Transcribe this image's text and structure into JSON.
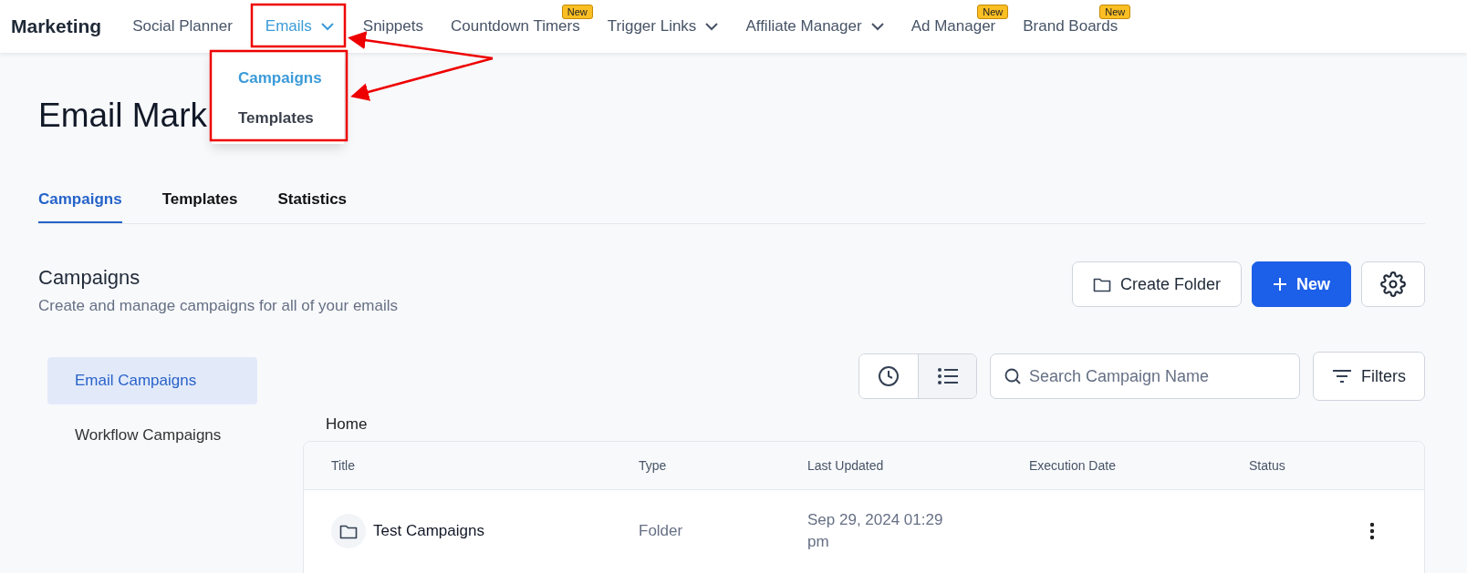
{
  "app_title": "Marketing",
  "nav": [
    {
      "label": "Social Planner",
      "selected": false,
      "dropdown": false
    },
    {
      "label": "Emails",
      "selected": true,
      "dropdown": true
    },
    {
      "label": "Snippets",
      "selected": false,
      "dropdown": false
    },
    {
      "label": "Countdown Timers",
      "selected": false,
      "dropdown": false,
      "badge": "New"
    },
    {
      "label": "Trigger Links",
      "selected": false,
      "dropdown": true
    },
    {
      "label": "Affiliate Manager",
      "selected": false,
      "dropdown": true
    },
    {
      "label": "Ad Manager",
      "selected": false,
      "dropdown": false,
      "badge": "New"
    },
    {
      "label": "Brand Boards",
      "selected": false,
      "dropdown": false,
      "badge": "New"
    }
  ],
  "dropdown_menu": [
    {
      "label": "Campaigns",
      "selected": true
    },
    {
      "label": "Templates",
      "selected": false
    }
  ],
  "page_title": "Email Mark",
  "tabs": [
    {
      "label": "Campaigns",
      "selected": true
    },
    {
      "label": "Templates",
      "selected": false
    },
    {
      "label": "Statistics",
      "selected": false
    }
  ],
  "section": {
    "title": "Campaigns",
    "subtitle": "Create and manage campaigns for all of your emails"
  },
  "actions": {
    "create_folder": "Create Folder",
    "new": "New"
  },
  "sidebar": [
    {
      "label": "Email Campaigns",
      "selected": true
    },
    {
      "label": "Workflow Campaigns",
      "selected": false
    }
  ],
  "view_toggle": [
    {
      "kind": "clock",
      "selected": false
    },
    {
      "kind": "list",
      "selected": true
    }
  ],
  "search": {
    "placeholder": "Search Campaign Name"
  },
  "filters": "Filters",
  "breadcrumb": "Home",
  "table": {
    "columns": [
      "Title",
      "Type",
      "Last Updated",
      "Execution Date",
      "Status"
    ],
    "rows": [
      {
        "title": "Test Campaigns",
        "type": "Folder",
        "last_updated": "Sep 29, 2024 01:29 pm"
      }
    ]
  }
}
